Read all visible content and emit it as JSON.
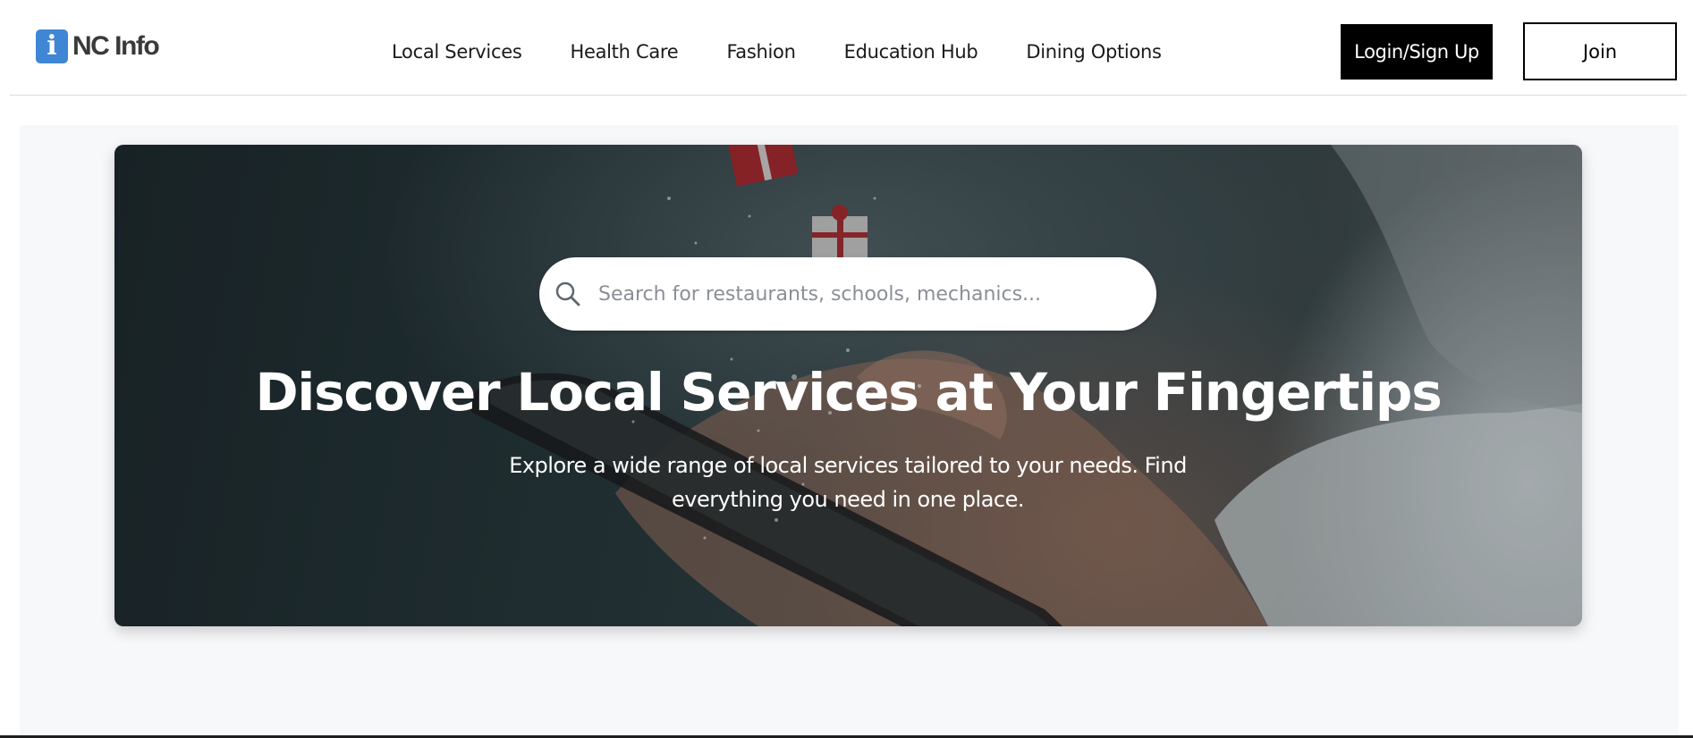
{
  "header": {
    "logo": {
      "badge_glyph": "i",
      "text": "NC Info",
      "badge_color": "#3f86d4"
    },
    "nav": [
      {
        "label": "Local Services"
      },
      {
        "label": "Health Care"
      },
      {
        "label": "Fashion"
      },
      {
        "label": "Education Hub"
      },
      {
        "label": "Dining Options"
      }
    ],
    "login_label": "Login/Sign Up",
    "join_label": "Join"
  },
  "hero": {
    "search": {
      "icon": "search-icon",
      "placeholder": "Search for restaurants, schools, mechanics...",
      "value": ""
    },
    "title": "Discover Local Services at Your Fingertips",
    "subtitle": "Explore a wide range of local services tailored to your needs. Find everything you need in one place."
  },
  "colors": {
    "primary_button": "#000000",
    "accent": "#3f86d4",
    "page_background": "#f7f8fa"
  }
}
